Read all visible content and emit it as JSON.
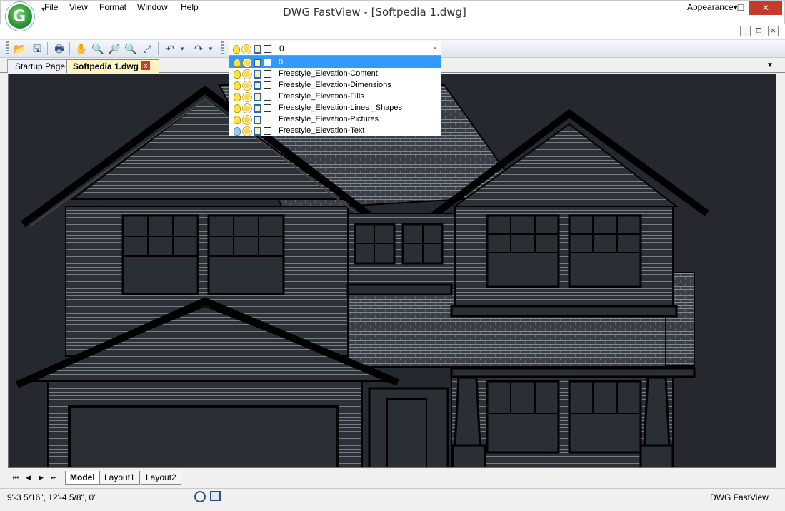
{
  "window": {
    "title": "DWG FastView - [Softpedia 1.dwg]",
    "min_glyph": "—",
    "max_glyph": "☐",
    "close_glyph": "✕"
  },
  "menu": {
    "file": "File",
    "view": "View",
    "format": "Format",
    "window": "Window",
    "help": "Help",
    "appearance": "Appearance▾"
  },
  "mdi": {
    "min": "_",
    "restore": "❐",
    "close": "✕"
  },
  "toolbar": {
    "icons": [
      "open-icon",
      "save-as-icon",
      "print-icon",
      "pan-icon",
      "zoom-icon",
      "zoom-in-icon",
      "zoom-window-icon",
      "zoom-extents-icon",
      "undo-icon",
      "redo-icon"
    ],
    "layer_value": "0"
  },
  "tabs": {
    "startup": "Startup Page",
    "document": "Softpedia 1.dwg",
    "close": "x",
    "list_arrow": "▼"
  },
  "layers": [
    {
      "name": "0",
      "bulb": "yellow",
      "selected": true
    },
    {
      "name": "Freestyle_Elevation-Content",
      "bulb": "yellow"
    },
    {
      "name": "Freestyle_Elevation-Dimensions",
      "bulb": "yellow"
    },
    {
      "name": "Freestyle_Elevation-Fills",
      "bulb": "yellow"
    },
    {
      "name": "Freestyle_Elevation-Lines _Shapes",
      "bulb": "yellow"
    },
    {
      "name": "Freestyle_Elevation-Pictures",
      "bulb": "yellow"
    },
    {
      "name": "Freestyle_Elevation-Text",
      "bulb": "blue"
    }
  ],
  "layouts": {
    "nav": [
      "⏮",
      "◀",
      "▶",
      "⏭"
    ],
    "model": "Model",
    "layout1": "Layout1",
    "layout2": "Layout2"
  },
  "status": {
    "coords": "9'-3 5/16\", 12'-4 5/8\", 0\"",
    "app_name": "DWG FastView"
  },
  "colors": {
    "canvas": "#25292f",
    "lines": "#000000",
    "roof_fill": "#3c4048",
    "selection": "#3399ff",
    "close_red": "#c7392c"
  }
}
